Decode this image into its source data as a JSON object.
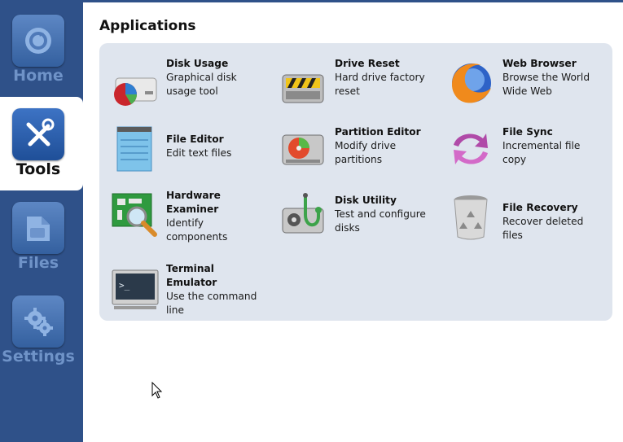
{
  "sidebar": {
    "items": [
      {
        "label": "Home",
        "icon": "home-icon",
        "active": false
      },
      {
        "label": "Tools",
        "icon": "tools-icon",
        "active": true
      },
      {
        "label": "Files",
        "icon": "files-icon",
        "active": false
      },
      {
        "label": "Settings",
        "icon": "settings-icon",
        "active": false
      }
    ]
  },
  "main": {
    "title": "Applications",
    "apps": [
      {
        "name": "Disk Usage",
        "desc": "Graphical disk usage tool",
        "icon": "disk-usage-icon"
      },
      {
        "name": "Drive Reset",
        "desc": "Hard drive factory reset",
        "icon": "drive-reset-icon"
      },
      {
        "name": "Web Browser",
        "desc": "Browse the World Wide Web",
        "icon": "web-browser-icon"
      },
      {
        "name": "File Editor",
        "desc": "Edit text files",
        "icon": "file-editor-icon"
      },
      {
        "name": "Partition Editor",
        "desc": "Modify drive partitions",
        "icon": "partition-editor-icon"
      },
      {
        "name": "File Sync",
        "desc": "Incremental file copy",
        "icon": "file-sync-icon"
      },
      {
        "name": "Hardware Examiner",
        "desc": "Identify components",
        "icon": "hardware-examiner-icon"
      },
      {
        "name": "Disk Utility",
        "desc": "Test and configure disks",
        "icon": "disk-utility-icon"
      },
      {
        "name": "File Recovery",
        "desc": "Recover deleted files",
        "icon": "file-recovery-icon"
      },
      {
        "name": "Terminal Emulator",
        "desc": "Use the command line",
        "icon": "terminal-emulator-icon"
      }
    ]
  },
  "colors": {
    "sidebar_bg": "#2f5189",
    "panel_bg": "#dfe5ee",
    "nav_label_inactive": "#6f93c8",
    "nav_label_active": "#111111"
  }
}
